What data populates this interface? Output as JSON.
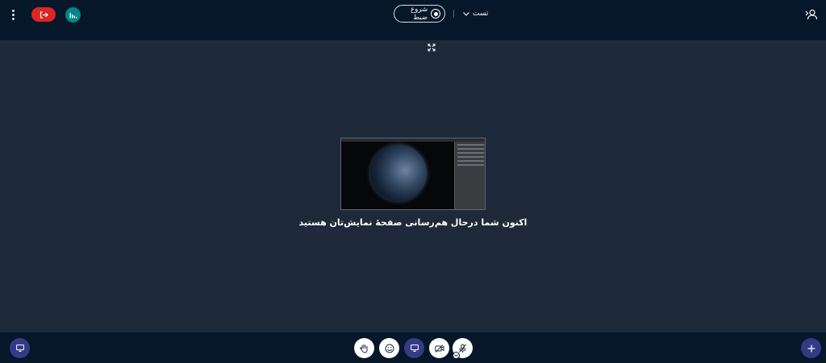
{
  "header": {
    "meeting_name": "تست",
    "record_label": "شروع ضبط"
  },
  "main": {
    "share_message": "اکنون شما درحال هم‌رسانی صفحهٔ نمایش‌تان هستید"
  },
  "icons": {
    "options": "kebab-icon",
    "leave": "exit-icon",
    "stats": "stats-icon",
    "user_list": "user-list-icon",
    "fullscreen": "fullscreen-icon",
    "raise_hand": "hand-icon",
    "reactions": "smiley-icon",
    "screenshare": "monitor-icon",
    "camera": "camera-off-icon",
    "mic": "mic-off-icon",
    "add": "plus-icon"
  },
  "colors": {
    "background": "#1e2a3a",
    "bars": "#06172a",
    "leave": "#e02424",
    "stats": "#00878a",
    "accent": "#333b86"
  }
}
